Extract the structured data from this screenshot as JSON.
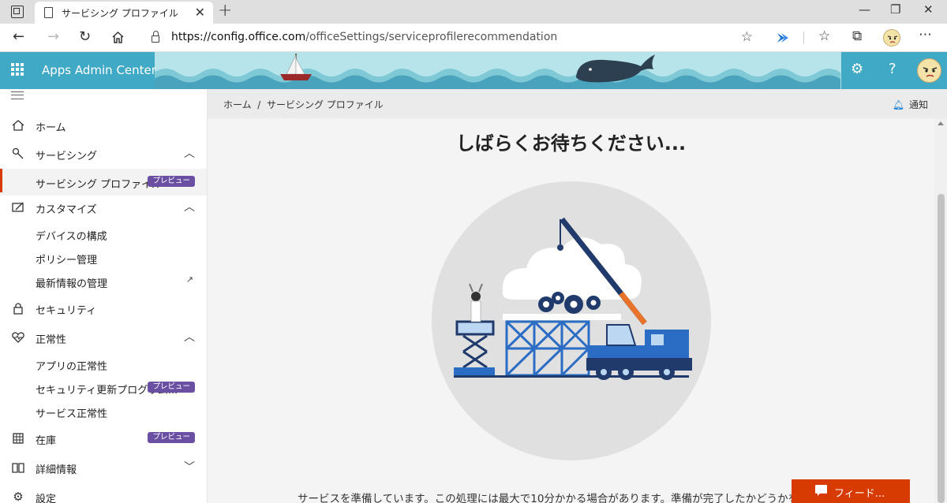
{
  "browser": {
    "tab_title": "サービシング プロファイル",
    "url_domain": "https://config.office.com",
    "url_path": "/officeSettings/serviceprofilerecommendation",
    "tab_close": "✕",
    "new_tab": "+",
    "window_controls": [
      "—",
      "❐",
      "✕"
    ]
  },
  "header": {
    "app_title": "Apps Admin Center",
    "icons": [
      "waffle-icon",
      "gear-icon",
      "help-icon",
      "avatar"
    ]
  },
  "sidebar": {
    "items": [
      {
        "label": "ホーム",
        "icon": "home-icon"
      },
      {
        "label": "サービシング",
        "icon": "servicing-icon",
        "chevron": "up"
      },
      {
        "label": "サービシング プロファイル",
        "badge": "プレビュー",
        "active": true
      },
      {
        "label": "カスタマイズ",
        "icon": "customize-icon",
        "chevron": "up"
      },
      {
        "label": "デバイスの構成"
      },
      {
        "label": "ポリシー管理"
      },
      {
        "label": "最新情報の管理",
        "external": true
      },
      {
        "label": "セキュリティ",
        "icon": "lock-icon"
      },
      {
        "label": "正常性",
        "icon": "heart-icon",
        "chevron": "up"
      },
      {
        "label": "アプリの正常性"
      },
      {
        "label": "セキュリティ更新プログラム...",
        "badge": "プレビュー"
      },
      {
        "label": "サービス正常性"
      },
      {
        "label": "在庫",
        "icon": "inventory-icon",
        "badge": "プレビュー"
      },
      {
        "label": "詳細情報",
        "icon": "book-icon",
        "chevron": "down"
      },
      {
        "label": "設定",
        "icon": "gear-icon"
      }
    ]
  },
  "breadcrumb": {
    "home": "ホーム",
    "separator": "/",
    "current": "サービシング プロファイル",
    "notify_label": "通知"
  },
  "main": {
    "title": "しばらくお待ちください...",
    "message": "サービスを準備しています。この処理には最大で10分かかる場合があります。準備が完了したかどうかを確認し"
  },
  "feedback": {
    "label": "フィード..."
  },
  "colors": {
    "accent": "#d83b01",
    "header": "#40a9c5",
    "badge": "#6b4fa3",
    "notify": "#0078d4"
  }
}
